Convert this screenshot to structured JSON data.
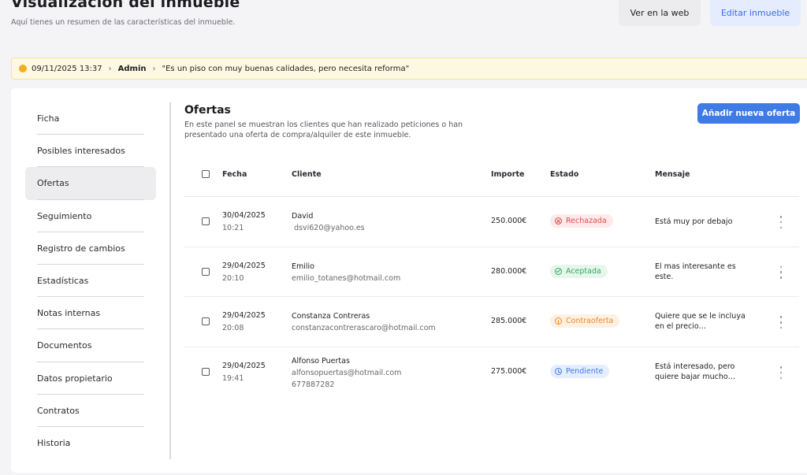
{
  "header": {
    "title": "Visualización del inmueble",
    "subtitle": "Aquí tienes un resumen de las características del inmueble.",
    "view_web_label": "Ver en la web",
    "edit_label": "Editar inmueble"
  },
  "alert": {
    "datetime": "09/11/2025 13:37",
    "user": "Admin",
    "message": "\"Es un piso con muy buenas calidades, pero necesita reforma\"",
    "separator": "›"
  },
  "sidebar": {
    "items": [
      {
        "label": "Ficha"
      },
      {
        "label": "Posibles interesados"
      },
      {
        "label": "Ofertas",
        "active": true
      },
      {
        "label": "Seguimiento"
      },
      {
        "label": "Registro de cambios"
      },
      {
        "label": "Estadísticas"
      },
      {
        "label": "Notas internas"
      },
      {
        "label": "Documentos"
      },
      {
        "label": "Datos propietario"
      },
      {
        "label": "Contratos"
      },
      {
        "label": "Historia"
      }
    ]
  },
  "offers": {
    "title": "Ofertas",
    "description": "En este panel se muestran los clientes que han realizado peticiones o han presentado una oferta de compra/alquiler de este inmueble.",
    "add_label": "Añadir nueva oferta",
    "columns": {
      "date": "Fecha",
      "client": "Cliente",
      "amount": "Importe",
      "status": "Estado",
      "message": "Mensaje"
    },
    "rows": [
      {
        "date": "30/04/2025",
        "time": "10:21",
        "name": "David",
        "email": " dsvi620@yahoo.es",
        "phone": "",
        "amount": "250.000€",
        "status": "Rechazada",
        "status_kind": "rejected",
        "status_color": "#e34b4b",
        "message": "Está muy por debajo"
      },
      {
        "date": "29/04/2025",
        "time": "20:10",
        "name": "Emilio",
        "email": "emilio_totanes@hotmail.com",
        "phone": "",
        "amount": "280.000€",
        "status": "Aceptada",
        "status_kind": "accepted",
        "status_color": "#2eaa5b",
        "message": "El mas interesante es este."
      },
      {
        "date": "29/04/2025",
        "time": "20:08",
        "name": "Constanza Contreras",
        "email": "constanzacontrerascaro@hotmail.com",
        "phone": "",
        "amount": "285.000€",
        "status": "Contraoferta",
        "status_kind": "counter",
        "status_color": "#ef8a24",
        "message": "Quiere que se le incluya en el precio…"
      },
      {
        "date": "29/04/2025",
        "time": "19:41",
        "name": "Alfonso Puertas",
        "email": "alfonsopuertas@hotmail.com",
        "phone": "677887282",
        "amount": "275.000€",
        "status": "Pendiente",
        "status_kind": "pending",
        "status_color": "#3f7be6",
        "message": "Está interesado, pero quiere bajar mucho…"
      }
    ]
  },
  "colors": {
    "accent": "#3f7be6",
    "alert_bg": "#fdf8e1",
    "alert_dot": "#f2b01e"
  }
}
